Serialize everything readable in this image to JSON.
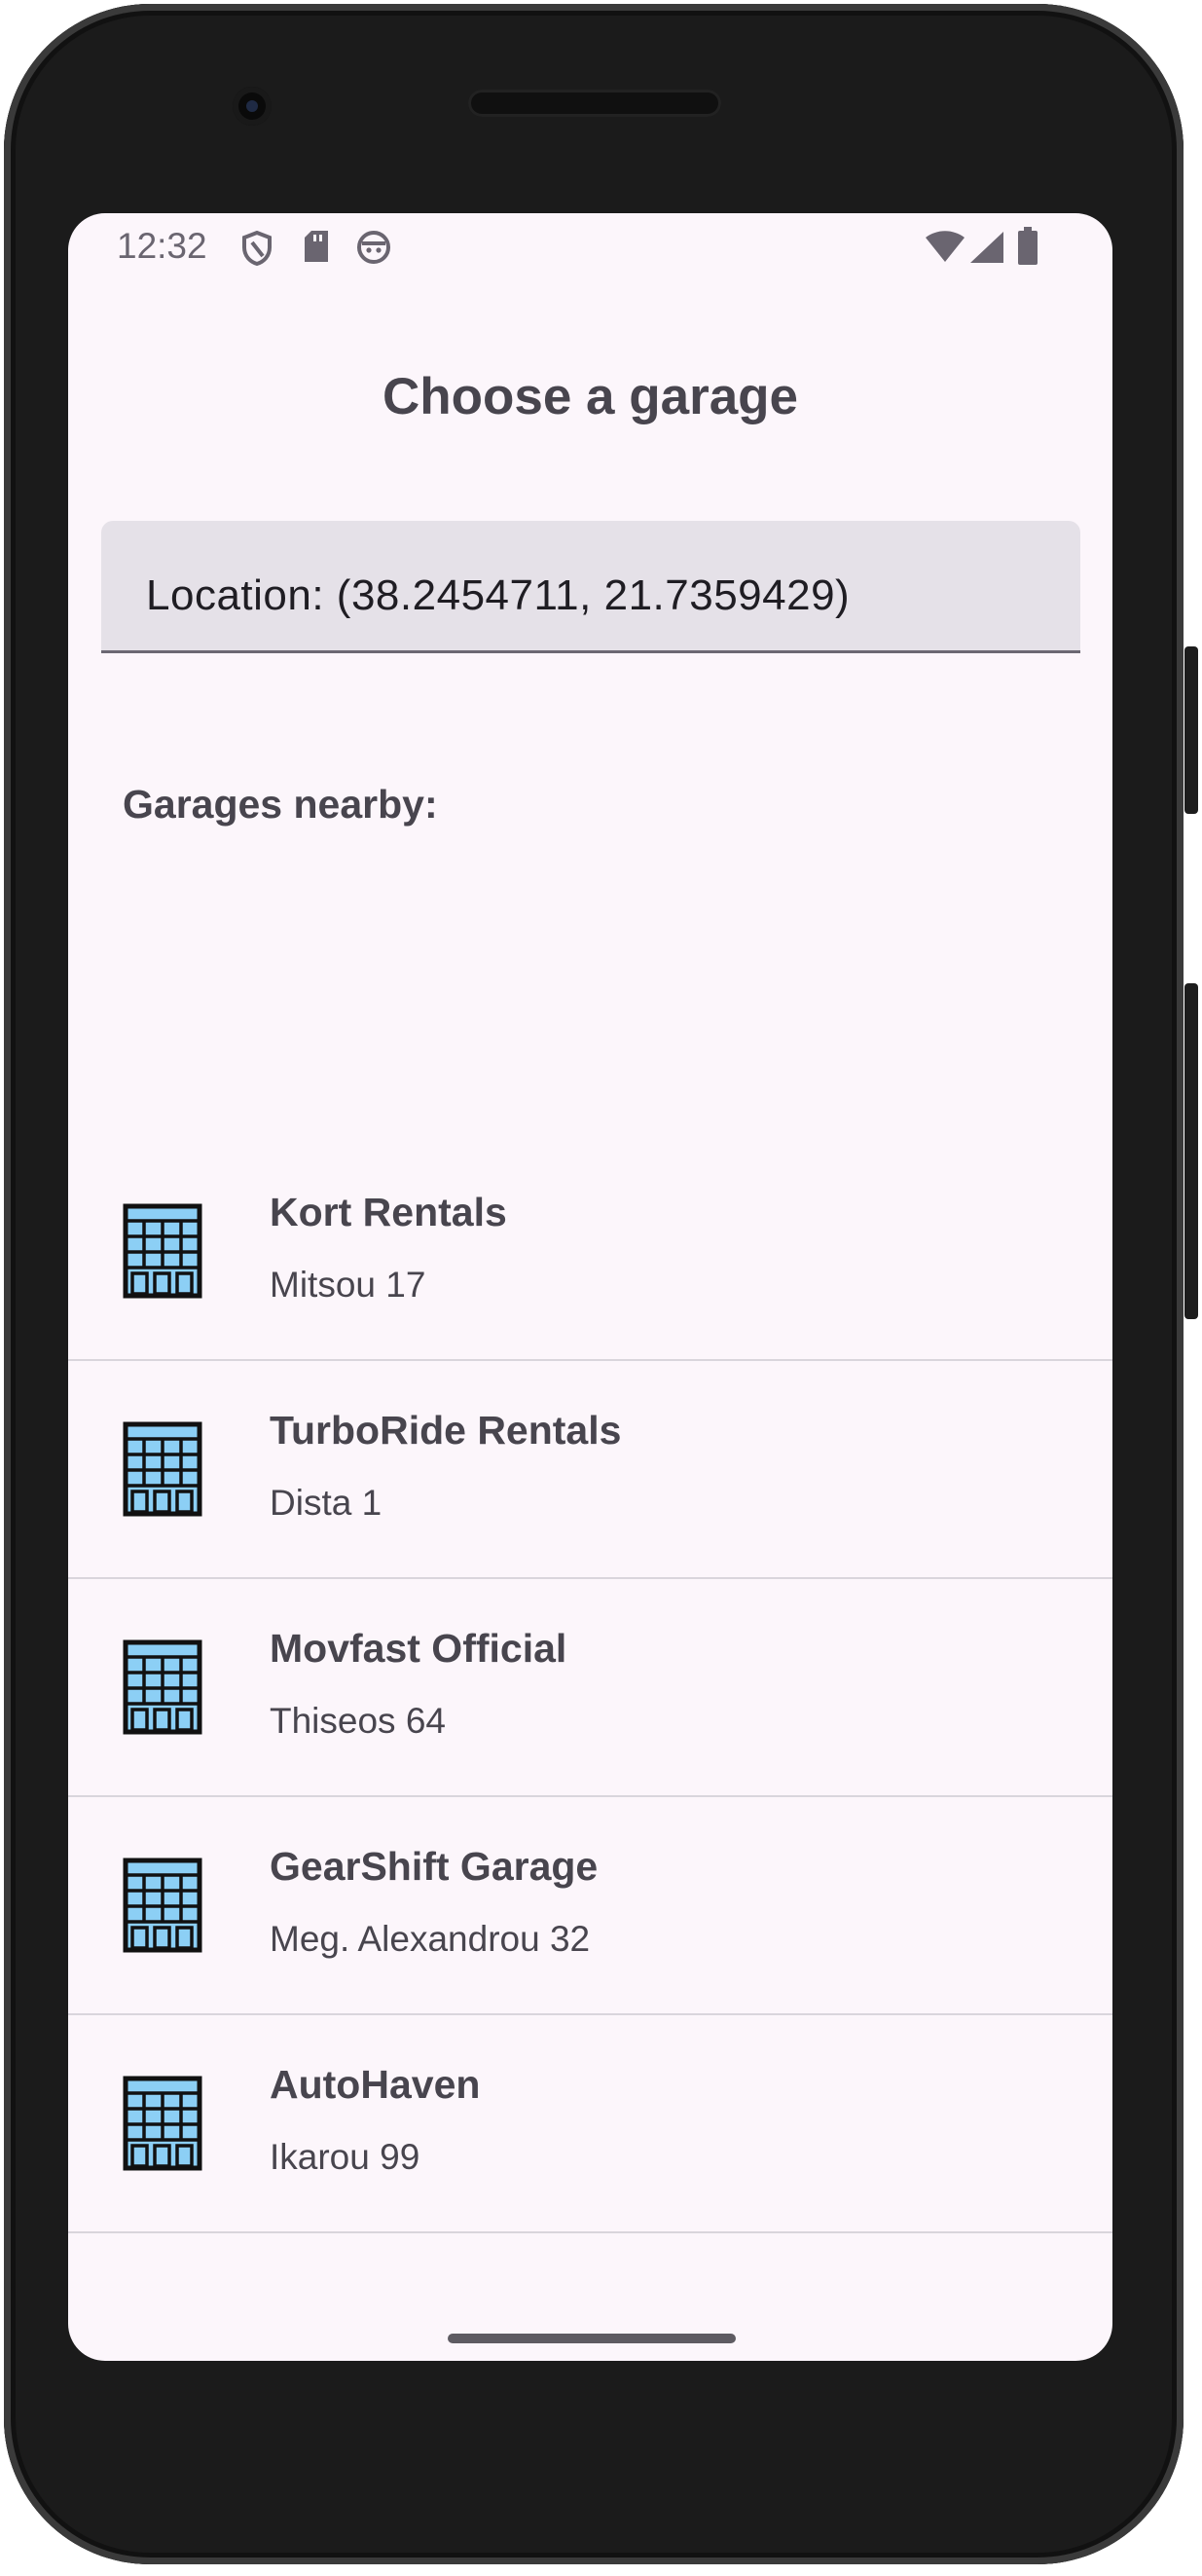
{
  "status_bar": {
    "time": "12:32",
    "left_icons": [
      "shield-icon",
      "sd-card-icon",
      "android-face-icon"
    ],
    "right_icons": [
      "wifi-icon",
      "signal-icon",
      "battery-icon"
    ]
  },
  "page": {
    "title": "Choose a garage"
  },
  "location_field": {
    "value": "Location: (38.2454711, 21.7359429)"
  },
  "garages_section": {
    "label": "Garages nearby:",
    "items": [
      {
        "name": "Kort Rentals",
        "address": "Mitsou 17",
        "icon": "building-icon"
      },
      {
        "name": "TurboRide Rentals",
        "address": "Dista 1",
        "icon": "building-icon"
      },
      {
        "name": "Movfast Official",
        "address": "Thiseos 64",
        "icon": "building-icon"
      },
      {
        "name": "GearShift Garage",
        "address": "Meg. Alexandrou 32",
        "icon": "building-icon"
      },
      {
        "name": "AutoHaven",
        "address": "Ikarou 99",
        "icon": "building-icon"
      }
    ]
  },
  "colors": {
    "screen_background": "#fcf6fb",
    "text_primary": "#48454e",
    "field_background": "#e5e1e8",
    "building_window": "#8ccff5"
  }
}
